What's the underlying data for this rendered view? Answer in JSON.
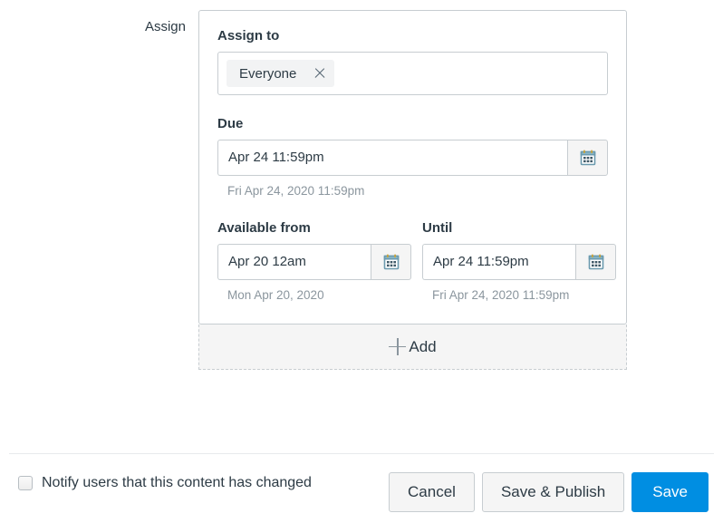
{
  "assign": {
    "row_label": "Assign",
    "assign_to": {
      "label": "Assign to",
      "tokens": [
        {
          "label": "Everyone",
          "remove_icon": "close-icon"
        }
      ]
    },
    "due": {
      "label": "Due",
      "value": "Apr 24 11:59pm",
      "hint": "Fri Apr 24, 2020 11:59pm",
      "calendar_icon": "calendar-icon"
    },
    "available_from": {
      "label": "Available from",
      "value": "Apr 20 12am",
      "hint": "Mon Apr 20, 2020",
      "calendar_icon": "calendar-icon"
    },
    "until": {
      "label": "Until",
      "value": "Apr 24 11:59pm",
      "hint": "Fri Apr 24, 2020 11:59pm",
      "calendar_icon": "calendar-icon"
    },
    "add": {
      "label": "Add",
      "icon": "plus-icon"
    }
  },
  "footer": {
    "notify_label": "Notify users that this content has changed",
    "notify_checked": false,
    "buttons": {
      "cancel": "Cancel",
      "save_and_publish": "Save & Publish",
      "save": "Save"
    }
  },
  "colors": {
    "primary": "#008EE2",
    "text": "#2D3B45",
    "border": "#C7CDD1",
    "hint": "#8B969E",
    "surface": "#F5F5F5"
  }
}
